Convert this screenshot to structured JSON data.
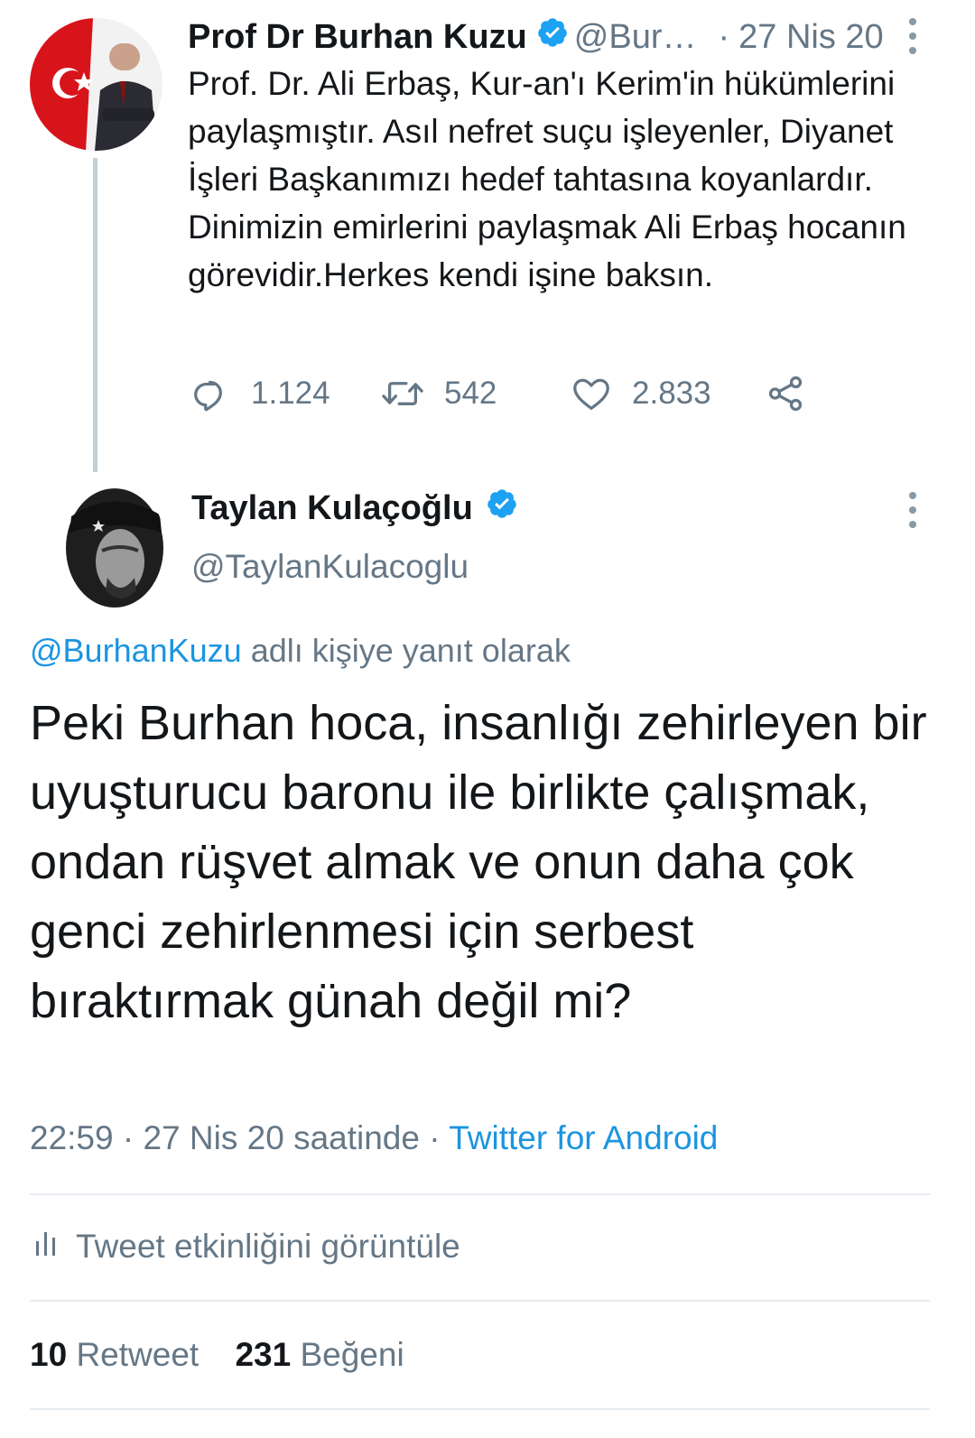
{
  "parent_tweet": {
    "author_name": "Prof Dr Burhan Kuzu",
    "handle": "@Bur…",
    "separator": "·",
    "date": "27 Nis 20",
    "text": "Prof. Dr. Ali Erbaş, Kur-an'ı Kerim'in hükümlerini paylaşmıştır. Asıl nefret suçu işleyenler, Diyanet İşleri Başkanımızı hedef tahtasına koyanlardır. Dinimizin emirlerini paylaşmak Ali Erbaş hocanın görevidir.Herkes kendi işine baksın.",
    "replies": "1.124",
    "retweets": "542",
    "likes": "2.833"
  },
  "reply_tweet": {
    "author_name": "Taylan Kulaçoğlu",
    "handle": "@TaylanKulacoglu",
    "reply_to_mention": "@BurhanKuzu",
    "reply_to_suffix": " adlı kişiye yanıt olarak",
    "text": "Peki Burhan hoca, insanlığı zehirleyen bir uyuşturucu baronu ile birlikte çalışmak, ondan rüşvet almak ve onun daha çok genci zehirlenmesi için serbest bıraktırmak günah değil mi?",
    "time": "22:59",
    "meta_separator": " · ",
    "date_text": "27 Nis 20 saatinde",
    "source": "Twitter for Android",
    "activity_label": "Tweet etkinliğini görüntüle",
    "retweet_count": "10",
    "retweet_label": "Retweet",
    "like_count": "231",
    "like_label": "Beğeni"
  },
  "icons": {
    "verified": "verified-badge-icon",
    "more": "more-vertical-icon",
    "reply": "reply-icon",
    "retweet": "retweet-icon",
    "like": "heart-icon",
    "share": "share-icon",
    "activity": "bar-chart-icon"
  },
  "colors": {
    "accent": "#1b95e0",
    "verified": "#1da1f2",
    "secondary_text": "#657786",
    "primary_text": "#14171a"
  }
}
